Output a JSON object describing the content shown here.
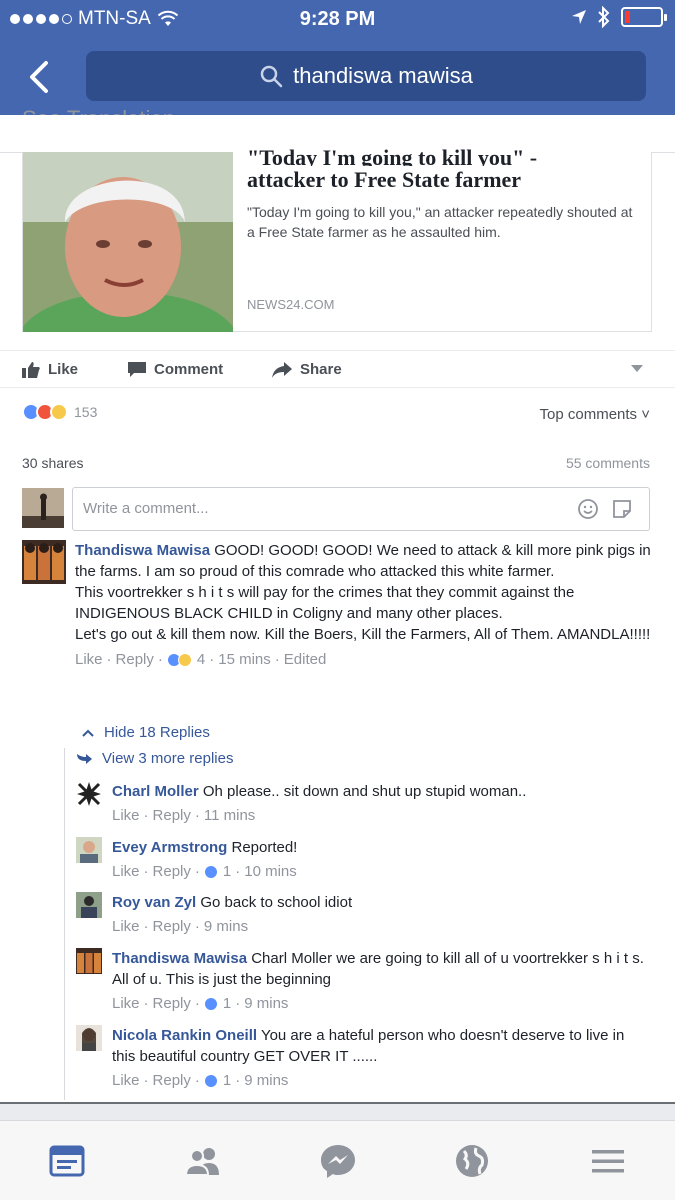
{
  "status": {
    "carrier": "MTN-SA",
    "time": "9:28 PM"
  },
  "search": {
    "query": "thandiswa mawisa"
  },
  "post": {
    "see_translation": "See Translation",
    "link": {
      "title_partial": "\"Today I'm going to kill you\" -",
      "title": "attacker to Free State farmer",
      "description": "\"Today I'm going to kill you,\" an attacker repeatedly shouted at a Free State farmer as he assaulted him.",
      "source": "NEWS24.COM"
    },
    "actions": {
      "like": "Like",
      "comment": "Comment",
      "share": "Share"
    },
    "reaction_count": "153",
    "sort_label": "Top comments",
    "shares": "30 shares",
    "comments_count": "55 comments",
    "write_placeholder": "Write a comment..."
  },
  "main_comment": {
    "author": "Thandiswa Mawisa",
    "line1": " GOOD! GOOD! GOOD! We need to attack & kill more pink pigs in the farms. I am so proud of this comrade who attacked this white farmer.",
    "line2": "This voortrekker s h i t s will pay for the crimes that they commit against the INDIGENOUS BLACK CHILD in Coligny and many other places.",
    "line3": "Let's go out & kill them now. Kill the Boers, Kill the Farmers, All of Them. AMANDLA!!!!!",
    "like": "Like",
    "reply": "Reply",
    "reaction_count": "4",
    "time": "15 mins",
    "edited": "Edited"
  },
  "thread": {
    "hide_label": "Hide 18 Replies",
    "view_more_label": "View 3 more replies"
  },
  "replies": [
    {
      "author": "Charl Moller",
      "text": " Oh please.. sit down and shut up stupid woman..",
      "like": "Like",
      "reply": "Reply",
      "count": "",
      "time": "11 mins"
    },
    {
      "author": "Evey Armstrong",
      "text": " Reported!",
      "like": "Like",
      "reply": "Reply",
      "count": "1",
      "time": "10 mins"
    },
    {
      "author": "Roy van Zyl",
      "text": " Go back to school idiot",
      "like": "Like",
      "reply": "Reply",
      "count": "",
      "time": "9 mins"
    },
    {
      "author": "Thandiswa Mawisa",
      "text": " Charl Moller we are going to kill all of u voortrekker s h i t s. All of u. This is just the beginning",
      "like": "Like",
      "reply": "Reply",
      "count": "1",
      "time": "9 mins"
    },
    {
      "author": "Nicola Rankin Oneill",
      "text": " You are a hateful person who doesn't deserve to live in this beautiful country GET OVER IT ......",
      "like": "Like",
      "reply": "Reply",
      "count": "1",
      "time": "9 mins"
    }
  ],
  "tabs": [
    {
      "icon": "news-feed-icon"
    },
    {
      "icon": "friends-icon"
    },
    {
      "icon": "messenger-icon"
    },
    {
      "icon": "globe-notifications-icon"
    },
    {
      "icon": "menu-icon"
    }
  ],
  "colors": {
    "brand": "#4467b0",
    "link": "#365899",
    "meta": "#90949c"
  }
}
